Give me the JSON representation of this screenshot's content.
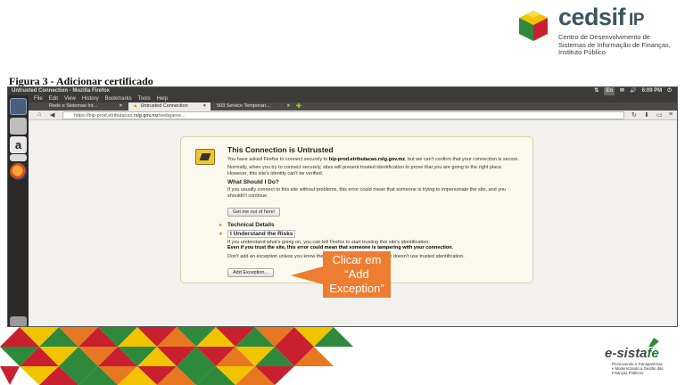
{
  "logo": {
    "word": "cedsif",
    "suffix": "IP",
    "description": "Centro de Desenvolvimento de\nSistemas de Informação de Finanças,\nInstituto Público"
  },
  "slide_title": "Figura 3 - Adicionar certificado",
  "window": {
    "title": "Untrusted Connection - Mozilla Firefox",
    "clock": "6:09 PM",
    "indicator": "En"
  },
  "menu": [
    "File",
    "Edit",
    "View",
    "History",
    "Bookmarks",
    "Tools",
    "Help"
  ],
  "tabs": [
    {
      "label": "Rede e Sistemas Int...",
      "active": false
    },
    {
      "label": "Untrusted Connection",
      "active": true
    },
    {
      "label": "503 Service Temporari...",
      "active": false
    }
  ],
  "url": {
    "prefix": "https://bip-prod.etributacao.",
    "domain": "rslg.gov.mz",
    "path": "/webgame..."
  },
  "page": {
    "title": "This Connection is Untrusted",
    "intro_pre": "You have asked Firefox to connect securely to ",
    "intro_host": "bip-prod.etributacao.rslg.gov.mz",
    "intro_post": ", but we can't confirm that your connection is secure.",
    "normal": "Normally, when you try to connect securely, sites will present trusted identification to prove that you are going to the right place. However, this site's identity can't be verified.",
    "what_title": "What Should I Do?",
    "what_text": "If you usually connect to this site without problems, this error could mean that someone is trying to impersonate the site, and you shouldn't continue.",
    "get_out": "Get me out of here!",
    "technical": "Technical Details",
    "understand": "I Understand the Risks",
    "risks_1": "If you understand what's going on, you can tell Firefox to start trusting this site's identification.",
    "risks_2": "Even if you trust the site, this error could mean that someone is tampering with your connection.",
    "risks_3": "Don't add an exception unless you know there's a good reason why this site doesn't use trusted identification.",
    "add_exception": "Add Exception..."
  },
  "callout": {
    "text": "Clicar em\n“Add\nException”",
    "color": "#ed7d31"
  },
  "esistafe": {
    "word_a": "e-sista",
    "word_b": "fe",
    "tagline": "Promovendo a Transparência\ne Modernizando a Gestão das\nFinanças Públicas"
  }
}
